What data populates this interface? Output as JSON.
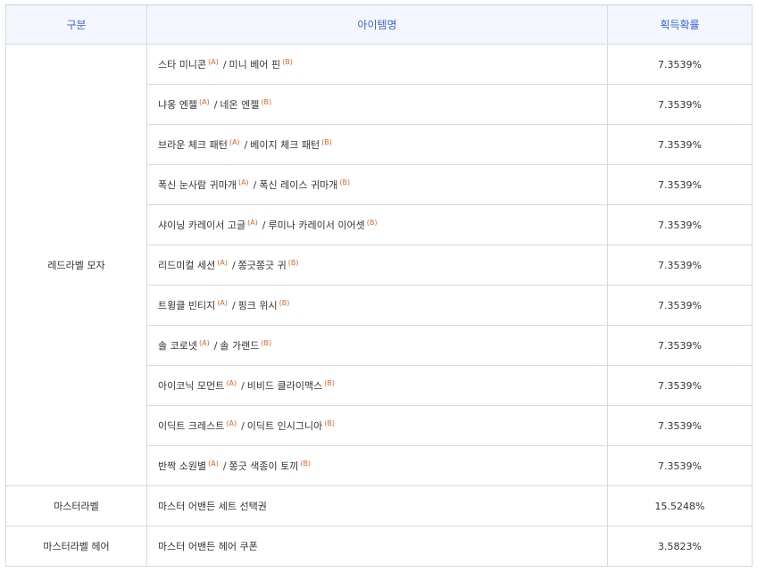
{
  "table": {
    "headers": [
      "구분",
      "아이템명",
      "획득확률"
    ],
    "groups": [
      {
        "category": "레드라벨 모자",
        "rows": [
          {
            "a": "스타 미니콘",
            "tag_a": "(A)",
            "sep": "/",
            "b": "미니 베어 핀",
            "tag_b": "(B)",
            "prob": "7.3539%"
          },
          {
            "a": "냐옹 엔젤",
            "tag_a": "(A)",
            "sep": "/",
            "b": "네온 엔젤",
            "tag_b": "(B)",
            "prob": "7.3539%"
          },
          {
            "a": "브라운 체크 패턴",
            "tag_a": "(A)",
            "sep": "/",
            "b": "베이지 체크 패턴",
            "tag_b": "(B)",
            "prob": "7.3539%"
          },
          {
            "a": "폭신 눈사람 귀마개",
            "tag_a": "(A)",
            "sep": "/",
            "b": "폭신 레이스 귀마개",
            "tag_b": "(B)",
            "prob": "7.3539%"
          },
          {
            "a": "샤이닝 카레이서 고글",
            "tag_a": "(A)",
            "sep": "/",
            "b": "루미나 카레이서 이어셋",
            "tag_b": "(B)",
            "prob": "7.3539%"
          },
          {
            "a": "리드미컬 세션",
            "tag_a": "(A)",
            "sep": "/",
            "b": "쫑긋쫑긋 귀",
            "tag_b": "(B)",
            "prob": "7.3539%"
          },
          {
            "a": "트윙클 빈티지",
            "tag_a": "(A)",
            "sep": "/",
            "b": "핑크 위시",
            "tag_b": "(B)",
            "prob": "7.3539%"
          },
          {
            "a": "솔 코로넷",
            "tag_a": "(A)",
            "sep": "/",
            "b": "솔 가랜드",
            "tag_b": "(B)",
            "prob": "7.3539%"
          },
          {
            "a": "아이코닉 모먼트",
            "tag_a": "(A)",
            "sep": "/",
            "b": "비비드 클라이맥스",
            "tag_b": "(B)",
            "prob": "7.3539%"
          },
          {
            "a": "이딕트 크레스트",
            "tag_a": "(A)",
            "sep": "/",
            "b": "이딕트 인시그니아",
            "tag_b": "(B)",
            "prob": "7.3539%"
          },
          {
            "a": "반짝 소원별",
            "tag_a": "(A)",
            "sep": "/",
            "b": "쫑긋 색종이 토끼",
            "tag_b": "(B)",
            "prob": "7.3539%"
          }
        ]
      },
      {
        "category": "마스터라벨",
        "rows": [
          {
            "a": "마스터 어밴든 세트 선택권",
            "prob": "15.5248%"
          }
        ]
      },
      {
        "category": "마스터라벨 헤어",
        "rows": [
          {
            "a": "마스터 어밴든 헤어 쿠폰",
            "prob": "3.5823%"
          }
        ]
      }
    ]
  },
  "colors": {
    "header_text": "#3a64d8",
    "header_bg": "#f3f6fc",
    "tag": "#e0662a",
    "border": "#d6d9de"
  }
}
